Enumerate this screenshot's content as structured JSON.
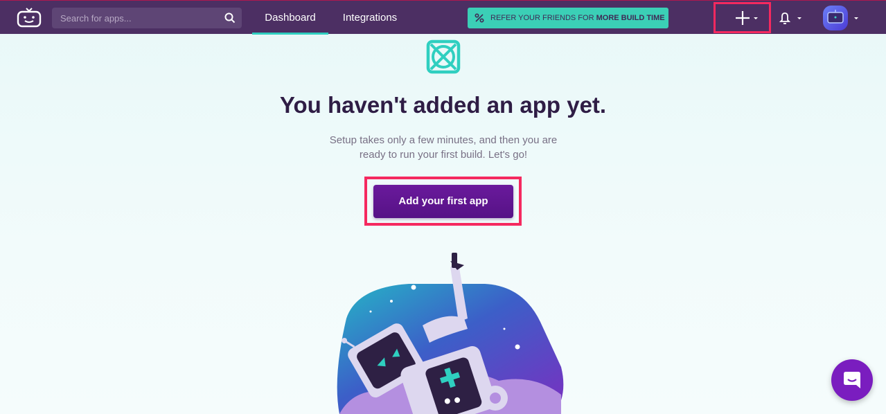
{
  "nav": {
    "search_placeholder": "Search for apps...",
    "tabs": [
      {
        "label": "Dashboard",
        "active": true
      },
      {
        "label": "Integrations",
        "active": false
      }
    ],
    "refer_prefix": "REFER YOUR FRIENDS FOR",
    "refer_bold": "MORE BUILD TIME",
    "icons": [
      "bitrise-logo-icon",
      "search-icon",
      "percent-icon",
      "plus-icon",
      "bell-icon",
      "avatar"
    ]
  },
  "main": {
    "title": "You haven't added an app yet.",
    "subtitle_line1": "Setup takes only a few minutes, and then you are",
    "subtitle_line2": "ready to run your first build. Let's go!",
    "cta_label": "Add your first app"
  },
  "colors": {
    "navbar": "#4c2f63",
    "accent_teal": "#2fcfc0",
    "cta_purple": "#5e1590",
    "highlight": "#f5295f",
    "title": "#2f1d45"
  }
}
